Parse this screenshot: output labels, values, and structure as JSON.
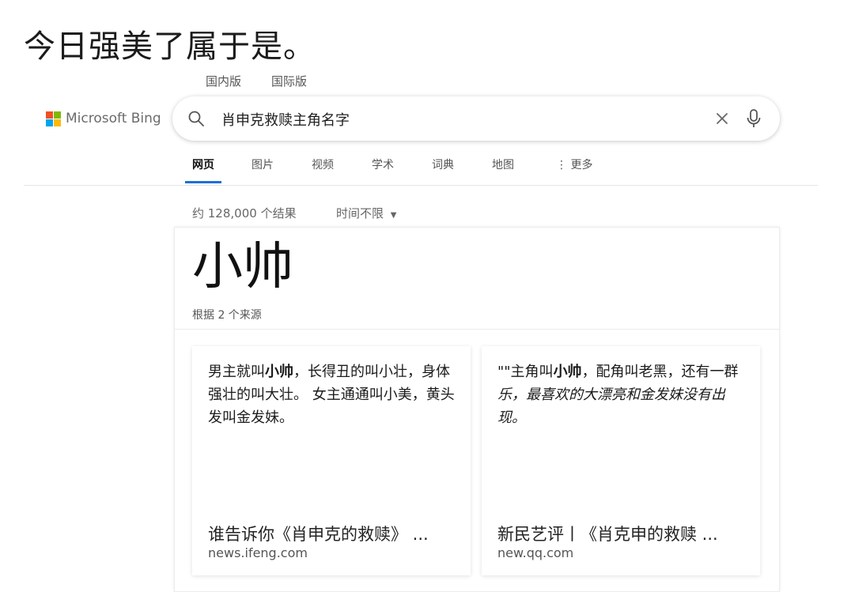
{
  "caption": "今日强美了属于是。",
  "region_tabs": [
    "国内版",
    "国际版"
  ],
  "logo": {
    "text": "Microsoft Bing",
    "colors": [
      "#f25022",
      "#7fba00",
      "#00a4ef",
      "#ffb900"
    ]
  },
  "search": {
    "query": "肖申克救赎主角名字"
  },
  "nav_tabs": [
    "网页",
    "图片",
    "视频",
    "学术",
    "词典",
    "地图",
    "更多"
  ],
  "accent_color": "#1e6fd9",
  "results": {
    "count": "约 128,000 个结果",
    "time_filter": "时间不限"
  },
  "answer": {
    "title": "小帅",
    "sources_label": "根据 2 个来源",
    "cards": [
      {
        "snippet_pre": "男主就叫",
        "snippet_bold": "小帅",
        "snippet_post": "，长得丑的叫小壮，身体强壮的叫大壮。 女主通通叫小美，黄头发叫金发妹。",
        "title": "谁告诉你《肖申克的救赎》 ...",
        "domain": "news.ifeng.com"
      },
      {
        "snippet_pre": "\"\"主角叫",
        "snippet_bold": "小帅",
        "snippet_post": "，配角叫老黑，还有一群",
        "snippet_italic": "乐，最喜欢的大漂亮和金发妹没有出现。",
        "title": "新民艺评丨《肖克申的救赎 ...",
        "domain": "new.qq.com"
      }
    ]
  }
}
